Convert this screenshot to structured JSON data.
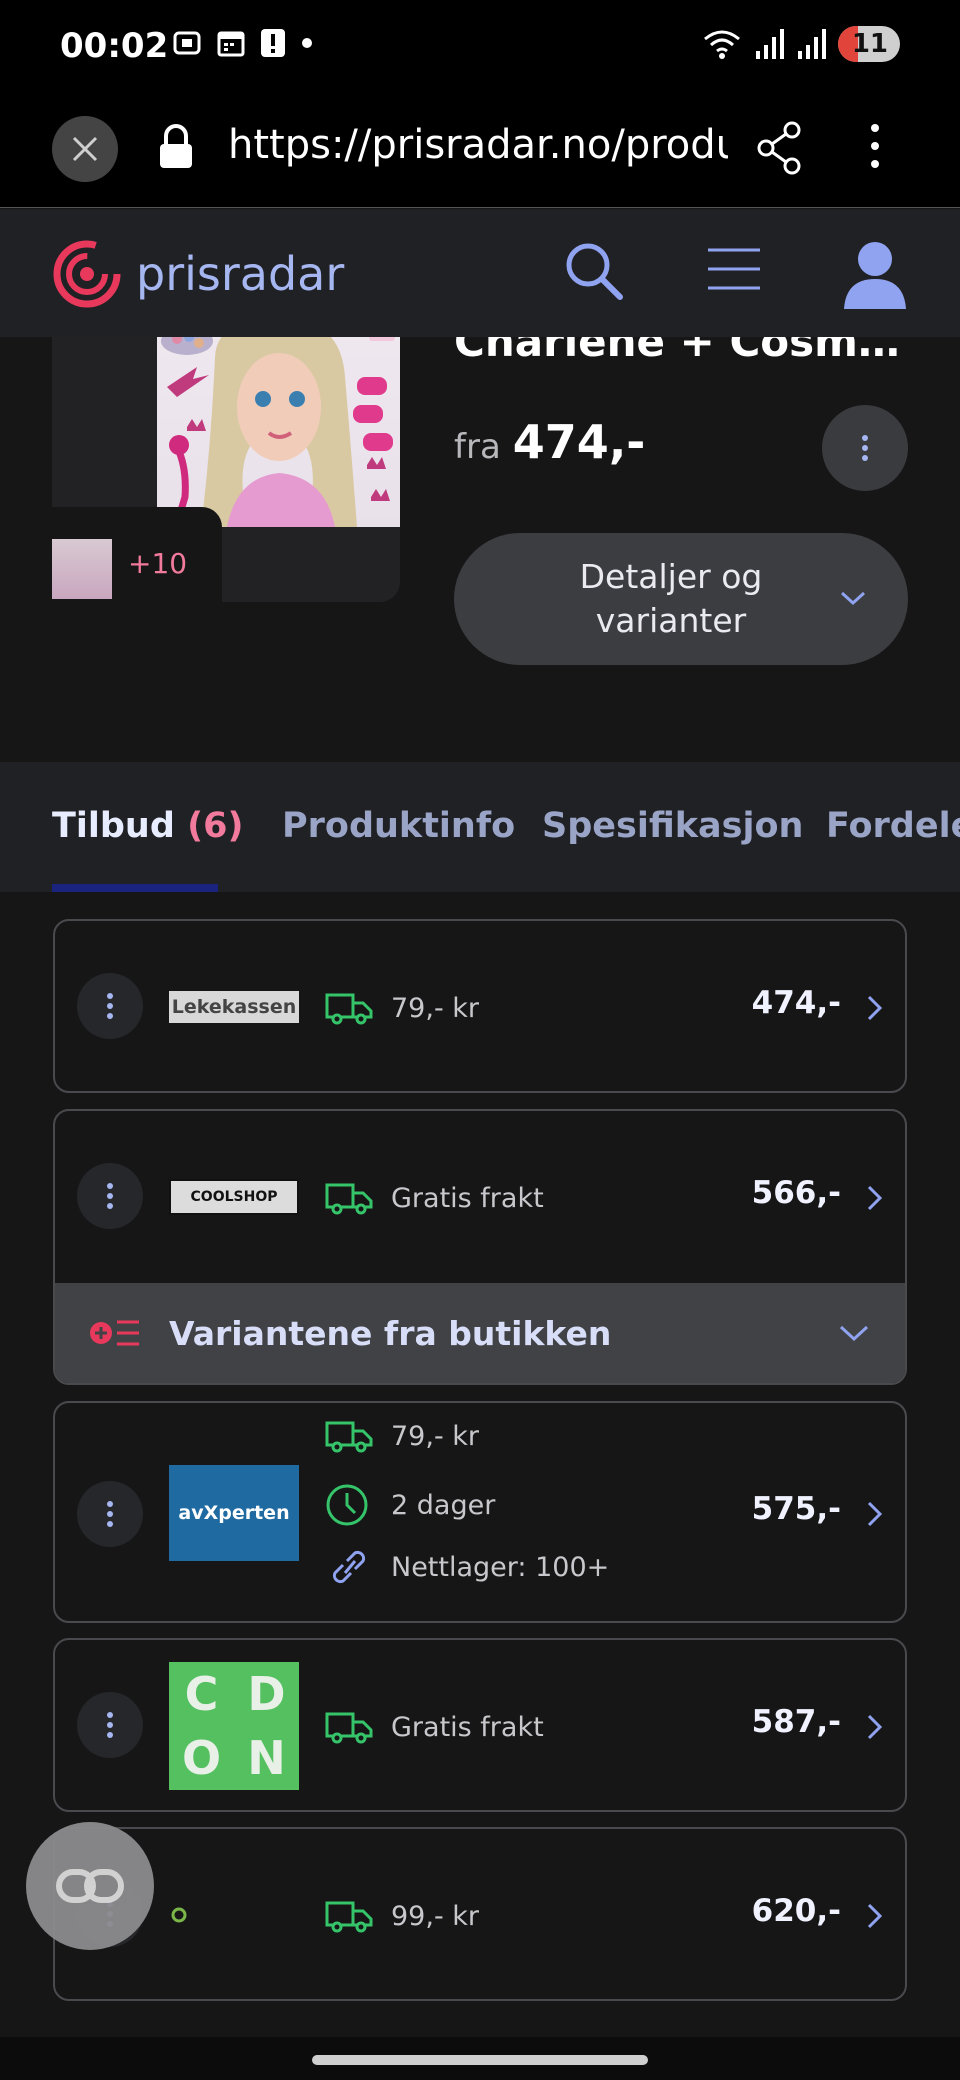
{
  "status_bar": {
    "time": "00:02",
    "battery": "11"
  },
  "browser": {
    "url": "https://prisradar.no/produ"
  },
  "site": {
    "logo_text": "prisradar",
    "brand_color": "#e8395c",
    "accent_color": "#8fa3f0"
  },
  "product": {
    "title": "Charlene + Cosmetics...",
    "price_prefix": "fra",
    "price": "474,-",
    "more_images": "+10",
    "details_button": "Detaljer og varianter"
  },
  "tabs": [
    {
      "label": "Tilbud",
      "count": "(6)"
    },
    {
      "label": "Produktinfo"
    },
    {
      "label": "Spesifikasjon"
    },
    {
      "label": "Fordeler"
    }
  ],
  "offers": [
    {
      "shop": "Lekekassen",
      "shipping": "79,- kr",
      "price": "474,-"
    },
    {
      "shop": "COOLSHOP",
      "shipping": "Gratis frakt",
      "price": "566,-",
      "variants_label": "Variantene fra butikken"
    },
    {
      "shop": "avXperten",
      "shipping": "79,- kr",
      "delivery": "2 dager",
      "stock": "Nettlager: 100+",
      "price": "575,-"
    },
    {
      "shop": "CDON",
      "logo_letters": [
        "C",
        "D",
        "O",
        "N"
      ],
      "shipping": "Gratis frakt",
      "price": "587,-"
    },
    {
      "shop": "",
      "shipping": "99,- kr",
      "price": "620,-"
    }
  ]
}
